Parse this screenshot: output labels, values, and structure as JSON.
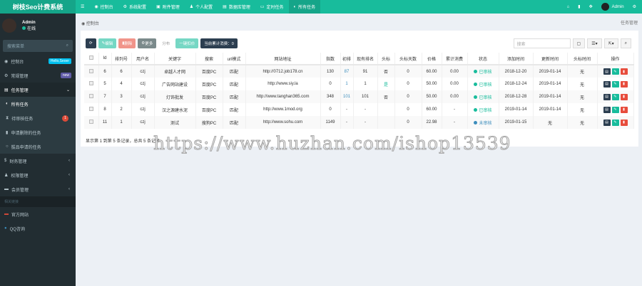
{
  "app_title": "树枝Seo计费系统",
  "nav": [
    "控制台",
    "系统配置",
    "附件管理",
    "个人配置",
    "数据库管理",
    "定时任务",
    "所有任务"
  ],
  "top_user": "Admin",
  "sidebar": {
    "user": "Admin",
    "status": "在线",
    "search_placeholder": "搜索菜单",
    "items": [
      {
        "label": "控制台",
        "badge": "Hello,Seoer"
      },
      {
        "label": "常规管理",
        "badge": "new"
      },
      {
        "label": "任务管理"
      }
    ],
    "sub": [
      "所有任务",
      "待审核任务",
      "申请删除的任务",
      "拔品申请的任务"
    ],
    "sub_badge": "1",
    "more": [
      "财务管理",
      "权限管理",
      "会员管理"
    ],
    "header": "相关链接",
    "links": [
      "官方网站",
      "QQ咨询"
    ]
  },
  "breadcrumb": "控制台",
  "breadcrumb_right": "任务管理",
  "toolbar": {
    "edit": "编辑",
    "delete": "删除",
    "more": "更多",
    "tab": "分布",
    "recharge": "一键扣价",
    "consume": "当前累计消费：0",
    "search_placeholder": "搜索"
  },
  "columns": [
    "",
    "Id",
    "排列号",
    "用户名",
    "关键字",
    "搜索",
    "url模式",
    "网站地址",
    "指数",
    "初排",
    "现有排名",
    "头标",
    "头标天数",
    "价格",
    "累计消费",
    "状态",
    "添加时间",
    "更新时间",
    "头标时间",
    "操作"
  ],
  "rows": [
    [
      "6",
      "6",
      "czj",
      "卓越人才网",
      "百度PC",
      "匹配",
      "http://0712.job178.cn",
      "130",
      "87",
      "91",
      "否",
      "0",
      "60.00",
      "0.00",
      "已审核",
      "2018-12-20",
      "2019-01-14",
      "无"
    ],
    [
      "5",
      "4",
      "czj",
      "广告网站建设",
      "百度PC",
      "匹配",
      "http://www.siy.la",
      "0",
      "1",
      "1",
      "是",
      "0",
      "50.00",
      "0.00",
      "已审核",
      "2018-12-24",
      "2019-01-14",
      "无"
    ],
    [
      "7",
      "3",
      "czj",
      "灯饰批发",
      "百度PC",
      "匹配",
      "http://www.tanghan365.com",
      "348",
      "101",
      "101",
      "否",
      "0",
      "50.00",
      "0.00",
      "已审核",
      "2018-12-28",
      "2019-01-14",
      "无"
    ],
    [
      "8",
      "2",
      "czj",
      "汉之源建水泥",
      "百度PC",
      "匹配",
      "http://www.1mod.org",
      "0",
      "-",
      "-",
      "",
      "0",
      "60.00",
      "-",
      "已审核",
      "2019-01-14",
      "2019-01-14",
      "无"
    ],
    [
      "11",
      "1",
      "czj",
      "测试",
      "搜狗PC",
      "匹配",
      "http://www.sohu.com",
      "1149",
      "-",
      "-",
      "",
      "0",
      "22.98",
      "-",
      "未审核",
      "2019-01-15",
      "无",
      "无"
    ]
  ],
  "footer": "显示第 1 到第 5 条记录，总共 5 条记录",
  "watermark": "https://www.huzhan.com/ishop13539",
  "colors": {
    "primary": "#18bc9c",
    "dark": "#2c3e50",
    "danger": "#e74c3c",
    "pending": "#3c8dbc"
  }
}
